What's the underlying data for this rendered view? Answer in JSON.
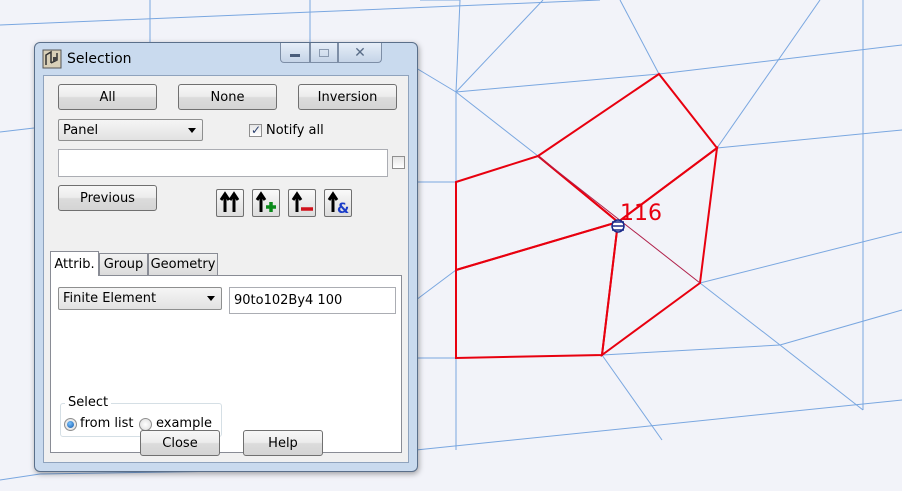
{
  "window": {
    "title": "Selection"
  },
  "buttons": {
    "all": "All",
    "none": "None",
    "inversion": "Inversion",
    "previous": "Previous",
    "close": "Close",
    "help": "Help"
  },
  "object_type": {
    "selected": "Panel"
  },
  "notify_all": {
    "label": "Notify all",
    "checked": true
  },
  "selection_field": {
    "value": ""
  },
  "tabs": [
    "Attrib.",
    "Group",
    "Geometry"
  ],
  "attrib": {
    "element_type": "Finite Element",
    "filter_value": "90to102By4 100"
  },
  "select_group": {
    "title": "Select",
    "options": [
      "from list",
      "example"
    ],
    "selected": "from list"
  },
  "viewport": {
    "node_label": "116",
    "selection_color": "#e8000f",
    "mesh_color": "#7aa7e0",
    "background": "#f2f3f9"
  },
  "icons": [
    "app-icon",
    "minimize-icon",
    "maximize-icon",
    "close-icon",
    "select-all-up-icon",
    "add-to-selection-icon",
    "remove-from-selection-icon",
    "intersect-selection-icon"
  ]
}
